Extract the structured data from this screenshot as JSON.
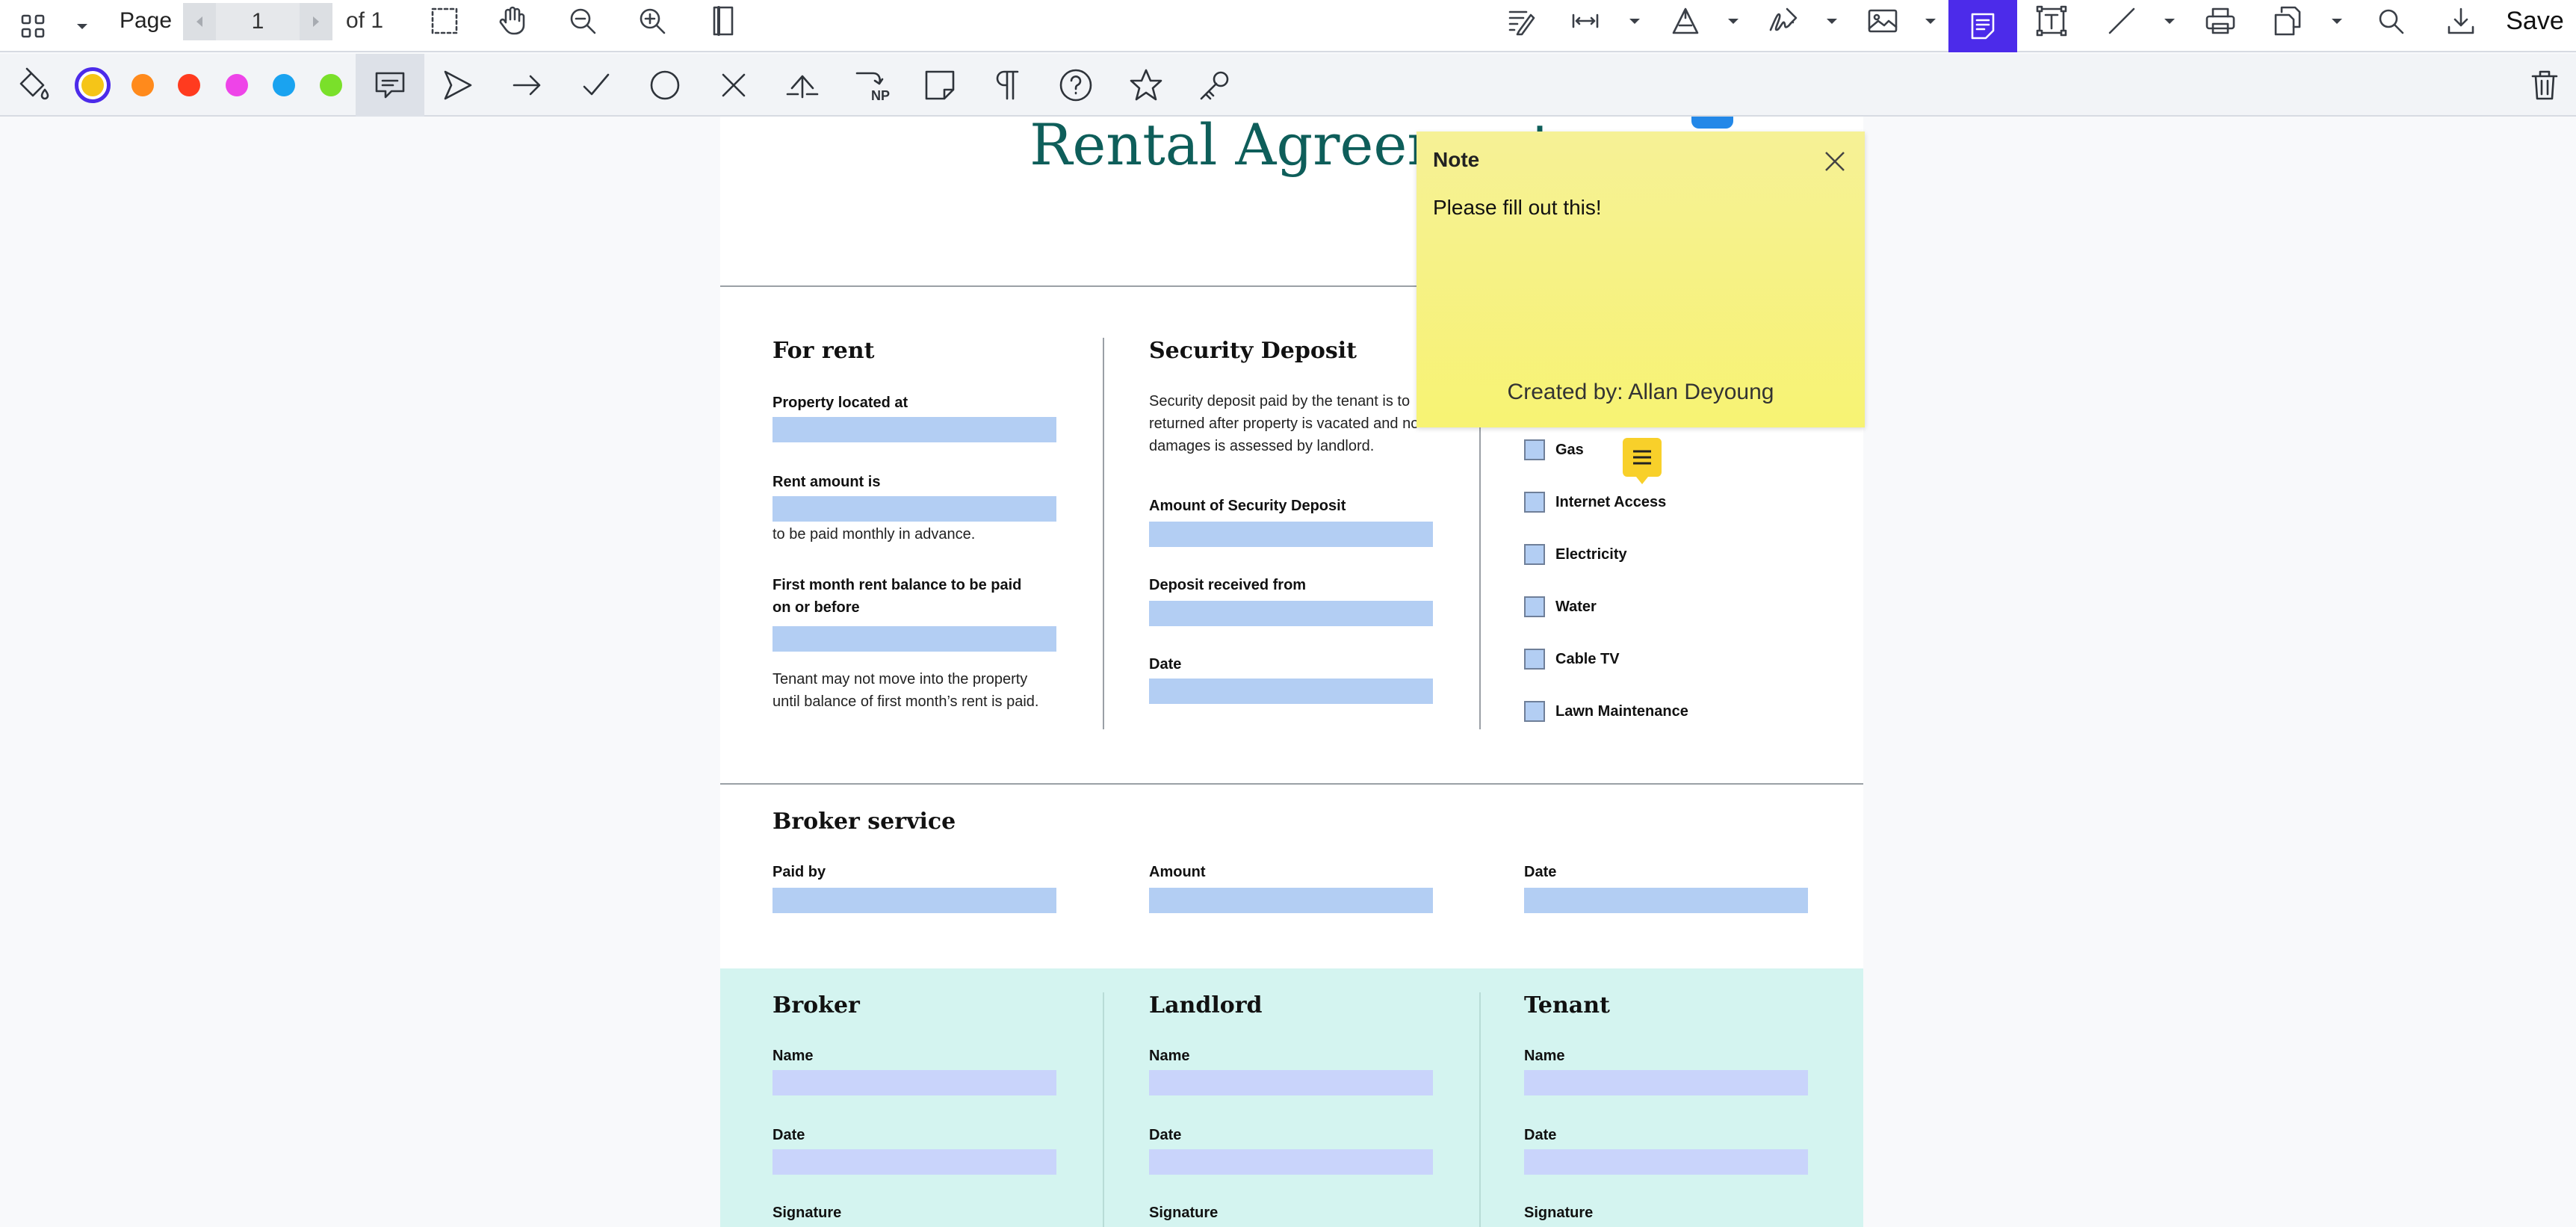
{
  "toolbar": {
    "page_label": "Page",
    "page_number": "1",
    "page_of": "of 1",
    "save_label": "Save",
    "icons": [
      "grid-icon",
      "chevron-down-icon",
      "marquee-select-icon",
      "pan-hand-icon",
      "zoom-out-icon",
      "zoom-in-icon",
      "single-page-view-icon",
      "form-edit-icon",
      "measure-icon",
      "fill-sign-icon",
      "signature-icon",
      "image-icon",
      "note-icon",
      "text-box-icon",
      "line-icon",
      "print-icon",
      "pages-icon",
      "search-icon",
      "download-icon"
    ]
  },
  "annotation_toolbar": {
    "colors": [
      "#f5c518",
      "#ff8a1c",
      "#ff3b1f",
      "#ee44e8",
      "#1aa3f0",
      "#7ae02a"
    ],
    "selected_color": "#f5c518",
    "np_label": "NP",
    "icons": [
      "paint-bucket-icon",
      "comment-icon",
      "triangle-arrow-icon",
      "arrow-icon",
      "check-icon",
      "circle-icon",
      "cross-icon",
      "insert-text-icon",
      "replace-text-icon",
      "sticky-note-icon",
      "paragraph-icon",
      "help-icon",
      "star-icon",
      "key-icon",
      "trash-icon"
    ]
  },
  "document": {
    "title": "Rental Agreement",
    "for_rent": {
      "heading": "For rent",
      "property_label": "Property located at",
      "rent_label": "Rent amount is",
      "rent_note": "to be paid monthly in advance.",
      "first_month_label_1": "First month rent balance to be paid",
      "first_month_label_2": "on or before",
      "tenant_note_1": "Tenant may not move into the property",
      "tenant_note_2": "until balance of first month’s rent is paid."
    },
    "security_deposit": {
      "heading": "Security Deposit",
      "desc_1": "Security deposit paid by the tenant is to",
      "desc_2": "returned after property is vacated and no",
      "desc_3": "damages is assessed by landlord.",
      "amount_label": "Amount of Security Deposit",
      "received_label": "Deposit received from",
      "date_label": "Date"
    },
    "utilities": [
      "Gas",
      "Internet Access",
      "Electricity",
      "Water",
      "Cable TV",
      "Lawn Maintenance"
    ],
    "broker_service": {
      "heading": "Broker service",
      "paid_by_label": "Paid by",
      "amount_label": "Amount",
      "date_label": "Date"
    },
    "signatures": [
      {
        "heading": "Broker",
        "name_label": "Name",
        "date_label": "Date",
        "signature_label": "Signature"
      },
      {
        "heading": "Landlord",
        "name_label": "Name",
        "date_label": "Date",
        "signature_label": "Signature"
      },
      {
        "heading": "Tenant",
        "name_label": "Name",
        "date_label": "Date",
        "signature_label": "Signature"
      }
    ]
  },
  "note": {
    "title": "Note",
    "body": "Please fill out this!",
    "author": "Created by: Allan Deyoung"
  }
}
